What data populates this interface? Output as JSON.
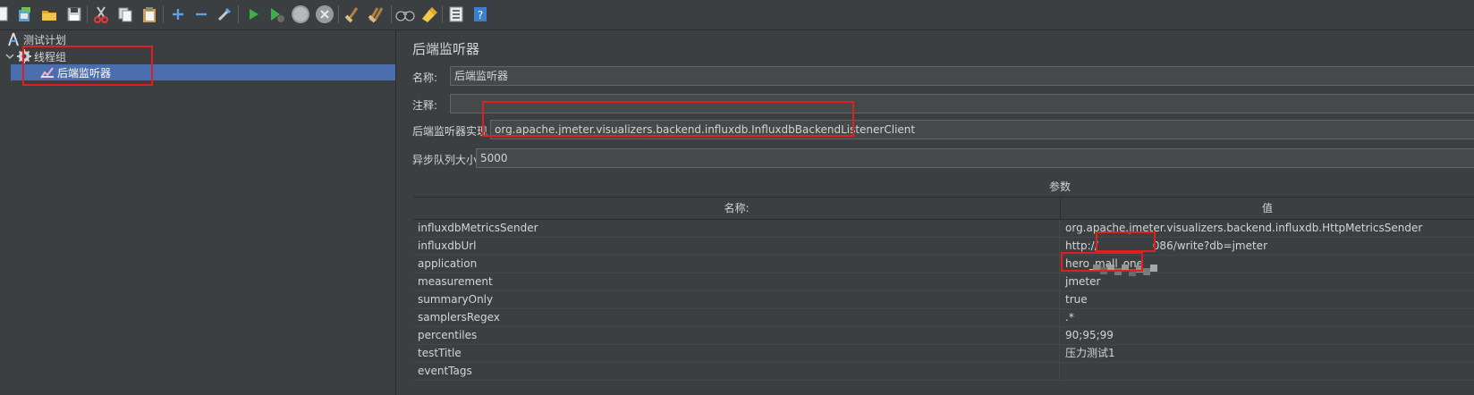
{
  "toolbar": {
    "icons": [
      "new-icon",
      "templates-icon",
      "open-icon",
      "save-icon",
      "cut-icon",
      "copy-icon",
      "paste-icon",
      "expand-icon",
      "collapse-icon",
      "toggle-icon",
      "start-icon",
      "start-no-pause-icon",
      "stop-icon",
      "shutdown-icon",
      "clear-icon",
      "clear-all-icon",
      "search-icon",
      "reset-search-icon",
      "function-helper-icon",
      "help-icon"
    ]
  },
  "tree": {
    "items": [
      {
        "label": "测试计划",
        "icon": "test-plan-icon"
      },
      {
        "label": "线程组",
        "icon": "gear-icon"
      },
      {
        "label": "后端监听器",
        "icon": "listener-icon"
      }
    ]
  },
  "panel": {
    "title": "后端监听器",
    "name_label": "名称:",
    "name_value": "后端监听器",
    "comment_label": "注释:",
    "comment_value": "",
    "impl_label": "后端监听器实现",
    "impl_value": "org.apache.jmeter.visualizers.backend.influxdb.InfluxdbBackendListenerClient",
    "queue_label": "异步队列大小",
    "queue_value": "5000",
    "params_title": "参数",
    "table": {
      "headers": [
        "名称:",
        "值"
      ],
      "rows": [
        {
          "name": "influxdbMetricsSender",
          "value": "org.apache.jmeter.visualizers.backend.influxdb.HttpMetricsSender"
        },
        {
          "name": "influxdbUrl",
          "value": "http://                086/write?db=jmeter"
        },
        {
          "name": "application",
          "value": "hero_mall_one"
        },
        {
          "name": "measurement",
          "value": "jmeter"
        },
        {
          "name": "summaryOnly",
          "value": "true"
        },
        {
          "name": "samplersRegex",
          "value": ".*"
        },
        {
          "name": "percentiles",
          "value": "90;95;99"
        },
        {
          "name": "testTitle",
          "value": "压力测试1"
        },
        {
          "name": "eventTags",
          "value": ""
        }
      ]
    }
  },
  "colors": {
    "background": "#3c3f41",
    "selection": "#4b6eaf",
    "annotation": "#e02020"
  }
}
